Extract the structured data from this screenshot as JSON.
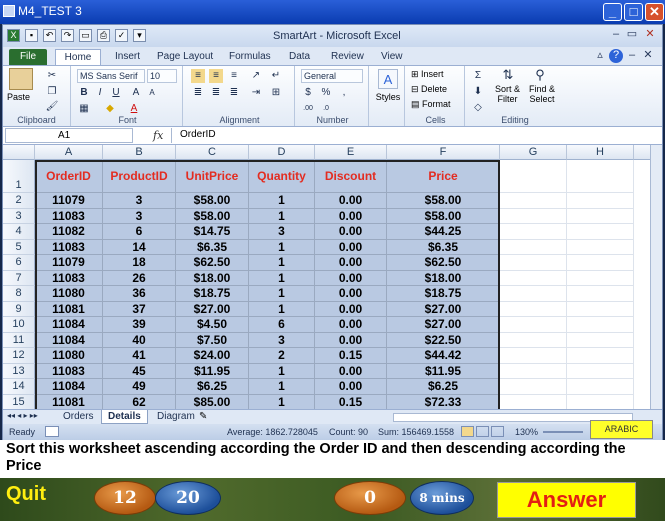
{
  "window": {
    "title": "M4_TEST 3"
  },
  "excel": {
    "title": "SmartArt  -  Microsoft Excel",
    "tabs": [
      "File",
      "Home",
      "Insert",
      "Page Layout",
      "Formulas",
      "Data",
      "Review",
      "View"
    ],
    "ribbon": {
      "clipboard": {
        "paste": "Paste",
        "label": "Clipboard"
      },
      "font": {
        "name": "MS Sans Serif",
        "size": "10",
        "label": "Font"
      },
      "alignment": {
        "label": "Alignment"
      },
      "number": {
        "format": "General",
        "label": "Number"
      },
      "styles": {
        "label": "Styles"
      },
      "cells": {
        "insert": "Insert",
        "delete": "Delete",
        "format": "Format",
        "label": "Cells"
      },
      "editing": {
        "sort": "Sort &",
        "filter": "Filter",
        "find": "Find &",
        "select": "Select",
        "label": "Editing"
      }
    },
    "formula_bar": {
      "name_box": "A1",
      "value": "OrderID"
    },
    "columns": [
      "A",
      "B",
      "C",
      "D",
      "E",
      "F",
      "G",
      "H"
    ],
    "headers": [
      "OrderID",
      "ProductID",
      "UnitPrice",
      "Quantity",
      "Discount",
      "Price"
    ],
    "rows": [
      {
        "n": "2",
        "cells": [
          "11079",
          "3",
          "$58.00",
          "1",
          "0.00",
          "$58.00"
        ]
      },
      {
        "n": "3",
        "cells": [
          "11083",
          "3",
          "$58.00",
          "1",
          "0.00",
          "$58.00"
        ]
      },
      {
        "n": "4",
        "cells": [
          "11082",
          "6",
          "$14.75",
          "3",
          "0.00",
          "$44.25"
        ]
      },
      {
        "n": "5",
        "cells": [
          "11083",
          "14",
          "$6.35",
          "1",
          "0.00",
          "$6.35"
        ]
      },
      {
        "n": "6",
        "cells": [
          "11079",
          "18",
          "$62.50",
          "1",
          "0.00",
          "$62.50"
        ]
      },
      {
        "n": "7",
        "cells": [
          "11083",
          "26",
          "$18.00",
          "1",
          "0.00",
          "$18.00"
        ]
      },
      {
        "n": "8",
        "cells": [
          "11080",
          "36",
          "$18.75",
          "1",
          "0.00",
          "$18.75"
        ]
      },
      {
        "n": "9",
        "cells": [
          "11081",
          "37",
          "$27.00",
          "1",
          "0.00",
          "$27.00"
        ]
      },
      {
        "n": "10",
        "cells": [
          "11084",
          "39",
          "$4.50",
          "6",
          "0.00",
          "$27.00"
        ]
      },
      {
        "n": "11",
        "cells": [
          "11084",
          "40",
          "$7.50",
          "3",
          "0.00",
          "$22.50"
        ]
      },
      {
        "n": "12",
        "cells": [
          "11080",
          "41",
          "$24.00",
          "2",
          "0.15",
          "$44.42"
        ]
      },
      {
        "n": "13",
        "cells": [
          "11083",
          "45",
          "$11.95",
          "1",
          "0.00",
          "$11.95"
        ]
      },
      {
        "n": "14",
        "cells": [
          "11084",
          "49",
          "$6.25",
          "1",
          "0.00",
          "$6.25"
        ]
      },
      {
        "n": "15",
        "cells": [
          "11081",
          "62",
          "$85.00",
          "1",
          "0.15",
          "$72.33"
        ]
      }
    ],
    "sheets": [
      "Orders",
      "Details",
      "Diagram"
    ],
    "active_sheet": "Details",
    "status": {
      "ready": "Ready",
      "average": "Average: 1862.728045",
      "count": "Count: 90",
      "sum": "Sum: 156469.1558",
      "zoom": "130%"
    }
  },
  "arabic_button": "ARABIC",
  "question": "Sort this worksheet ascending according the Order ID and then descending according the Price",
  "game": {
    "quit": "Quit",
    "counter_a": "12",
    "counter_b": "20",
    "score": "0",
    "timer": "8 mins",
    "answer": "Answer"
  },
  "colors": {
    "header_text": "#e32c21",
    "data_fill": "#b9c9e2",
    "answer_bg": "#ffff00",
    "quit_text": "#ffee10"
  }
}
